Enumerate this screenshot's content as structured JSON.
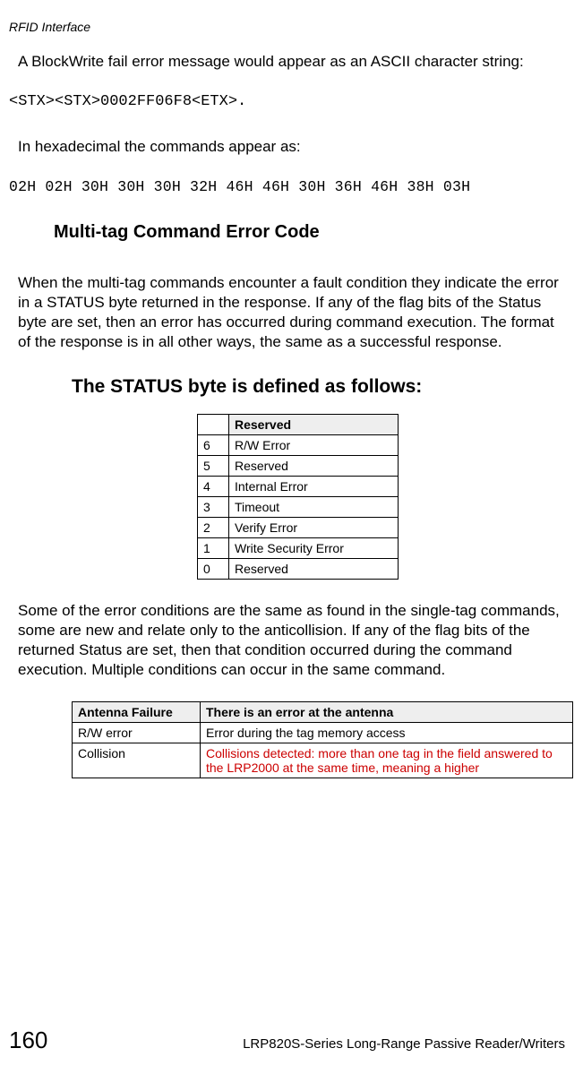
{
  "header": {
    "running": "RFID Interface"
  },
  "p1": "A BlockWrite fail error message would appear as an ASCII character string:",
  "code1": "<STX><STX>0002FF06F8<ETX>.",
  "p2": "In hexadecimal the commands appear as:",
  "code2": "02H 02H 30H 30H 30H 32H 46H 46H 30H 36H 46H 38H 03H",
  "section_title": "Multi-tag Command Error Code",
  "p3": "When the multi-tag commands encounter a fault condition they indicate the error in a STATUS byte returned in the response. If any of the flag bits of the Status byte are set, then an error has occurred during command execution. The format of the response is in all other ways, the same as a successful response.",
  "subsection_title": "The STATUS byte is defined as follows:",
  "status_table": {
    "header": "Reserved",
    "rows": [
      {
        "bit": "6",
        "label": "R/W Error"
      },
      {
        "bit": "5",
        "label": "Reserved"
      },
      {
        "bit": "4",
        "label": "Internal Error"
      },
      {
        "bit": "3",
        "label": "Timeout"
      },
      {
        "bit": "2",
        "label": "Verify Error"
      },
      {
        "bit": "1",
        "label": "Write Security Error"
      },
      {
        "bit": "0",
        "label": "Reserved"
      }
    ]
  },
  "p4": "Some of the error conditions are the same as found in the single-tag commands, some are new and relate only to the anticollision.  If any of the flag bits of the returned Status are set, then that condition occurred during the command execution. Multiple conditions can occur in the same command.",
  "errors_table": {
    "head_left": "Antenna Failure",
    "head_right": "There is an error at the antenna",
    "rows": [
      {
        "name": "R/W error",
        "desc": "Error during the tag memory access",
        "red": false
      },
      {
        "name": "Collision",
        "desc": "Collisions detected: more than one tag in the field answered to the LRP2000 at the same time, meaning a higher",
        "red": true
      }
    ]
  },
  "footer": {
    "page": "160",
    "doc": "LRP820S-Series Long-Range Passive Reader/Writers"
  }
}
